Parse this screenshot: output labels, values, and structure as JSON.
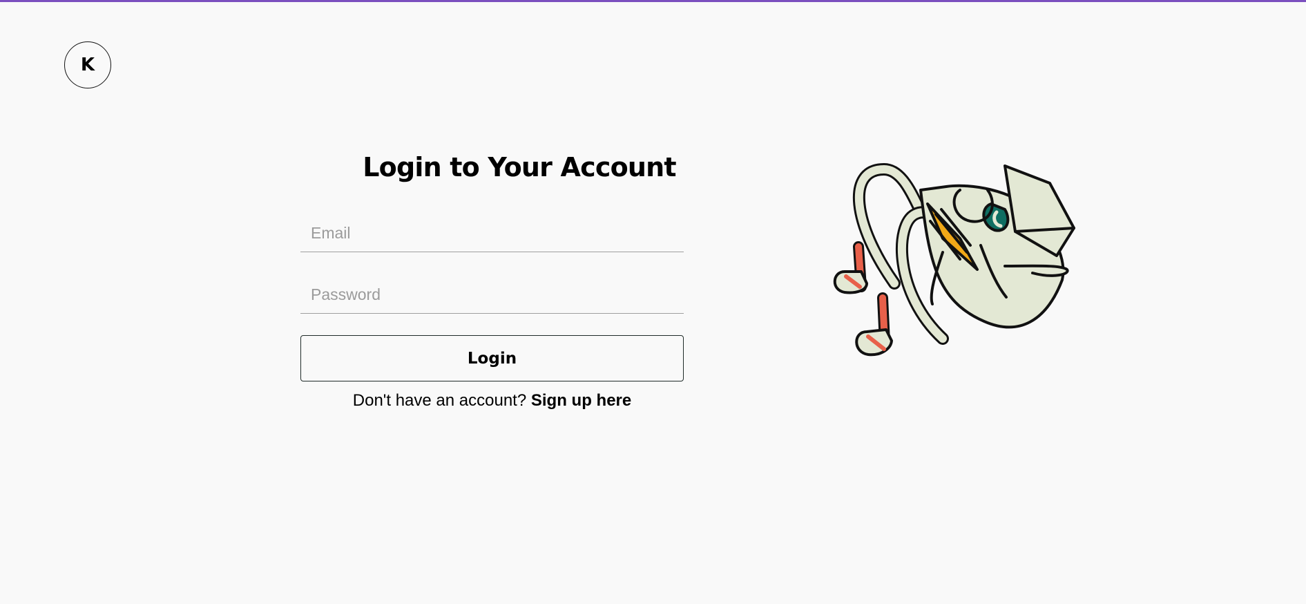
{
  "colors": {
    "top_accent": "#7b4fbf",
    "background": "#f9f9f9",
    "mascot_body": "#e3e8d4",
    "mascot_sock": "#e8604a",
    "mascot_eye": "#0f6e62",
    "mascot_book": "#f0a818"
  },
  "header": {
    "logo_letter": "K"
  },
  "login": {
    "title": "Login to Your Account",
    "email_placeholder": "Email",
    "password_placeholder": "Password",
    "button_label": "Login",
    "signup_prompt": "Don't have an account?",
    "signup_link": "Sign up here"
  },
  "illustration": {
    "icon": "mascot-illustration"
  }
}
